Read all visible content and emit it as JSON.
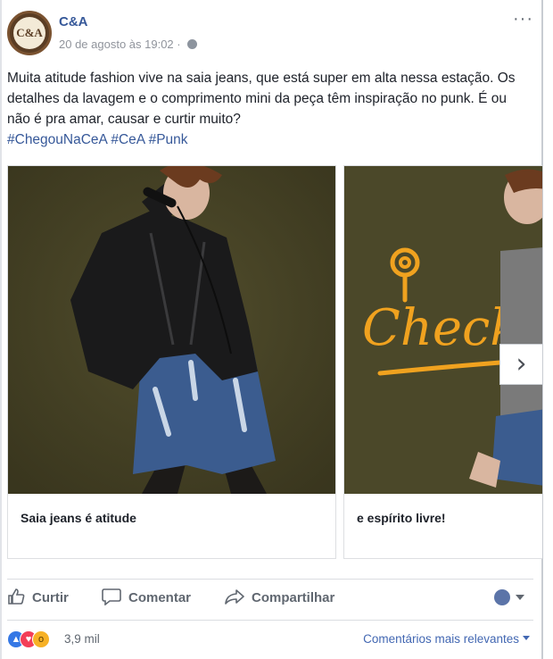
{
  "post": {
    "page_name": "C&A",
    "avatar_text": "C&A",
    "timestamp": "20 de agosto às 19:02 ·",
    "more_icon": "···",
    "text": "Muita atitude fashion vive na saia jeans, que está super em alta nessa estação. Os detalhes da lavagem e o comprimento mini da peça têm inspiração no punk. É ou não é pra amar, causar e curtir muito?",
    "hashtags": [
      "#ChegouNaCeA",
      "#CeA",
      "#Punk"
    ]
  },
  "carousel": {
    "slides": [
      {
        "caption": "Saia jeans é atitude"
      },
      {
        "caption": "e espírito livre!",
        "overlay_text": "Check-in"
      }
    ],
    "next_icon": "›"
  },
  "actions": {
    "like_label": "Curtir",
    "comment_label": "Comentar",
    "share_label": "Compartilhar"
  },
  "footer": {
    "reactions": [
      "like",
      "love",
      "wow"
    ],
    "reaction_count": "3,9 mil",
    "sort_label": "Comentários mais relevantes"
  },
  "colors": {
    "link": "#365899",
    "accent": "#4267b2",
    "muted": "#606770",
    "checkin_orange": "#f0a21f"
  }
}
